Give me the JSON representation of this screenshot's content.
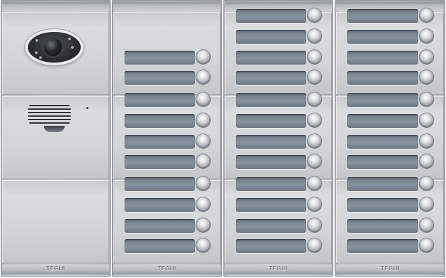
{
  "brand": "TEGUI",
  "panel": {
    "columns": [
      {
        "id": "control",
        "modules": [
          "camera",
          "speaker",
          "blank"
        ]
      },
      {
        "id": "col2",
        "rows_per_module": [
          2,
          4,
          4
        ]
      },
      {
        "id": "col3",
        "rows_per_module": [
          4,
          4,
          4
        ]
      },
      {
        "id": "col4",
        "rows_per_module": [
          4,
          4,
          4
        ]
      }
    ],
    "total_call_buttons": 34
  },
  "colors": {
    "frame": "#d3d6d8",
    "label_window": "#7b8692",
    "button": "#dfe2e4",
    "camera_bezel": "#2c3034"
  },
  "icons": [
    "camera-icon",
    "speaker-grille-icon",
    "microphone-icon",
    "call-button-icon"
  ]
}
